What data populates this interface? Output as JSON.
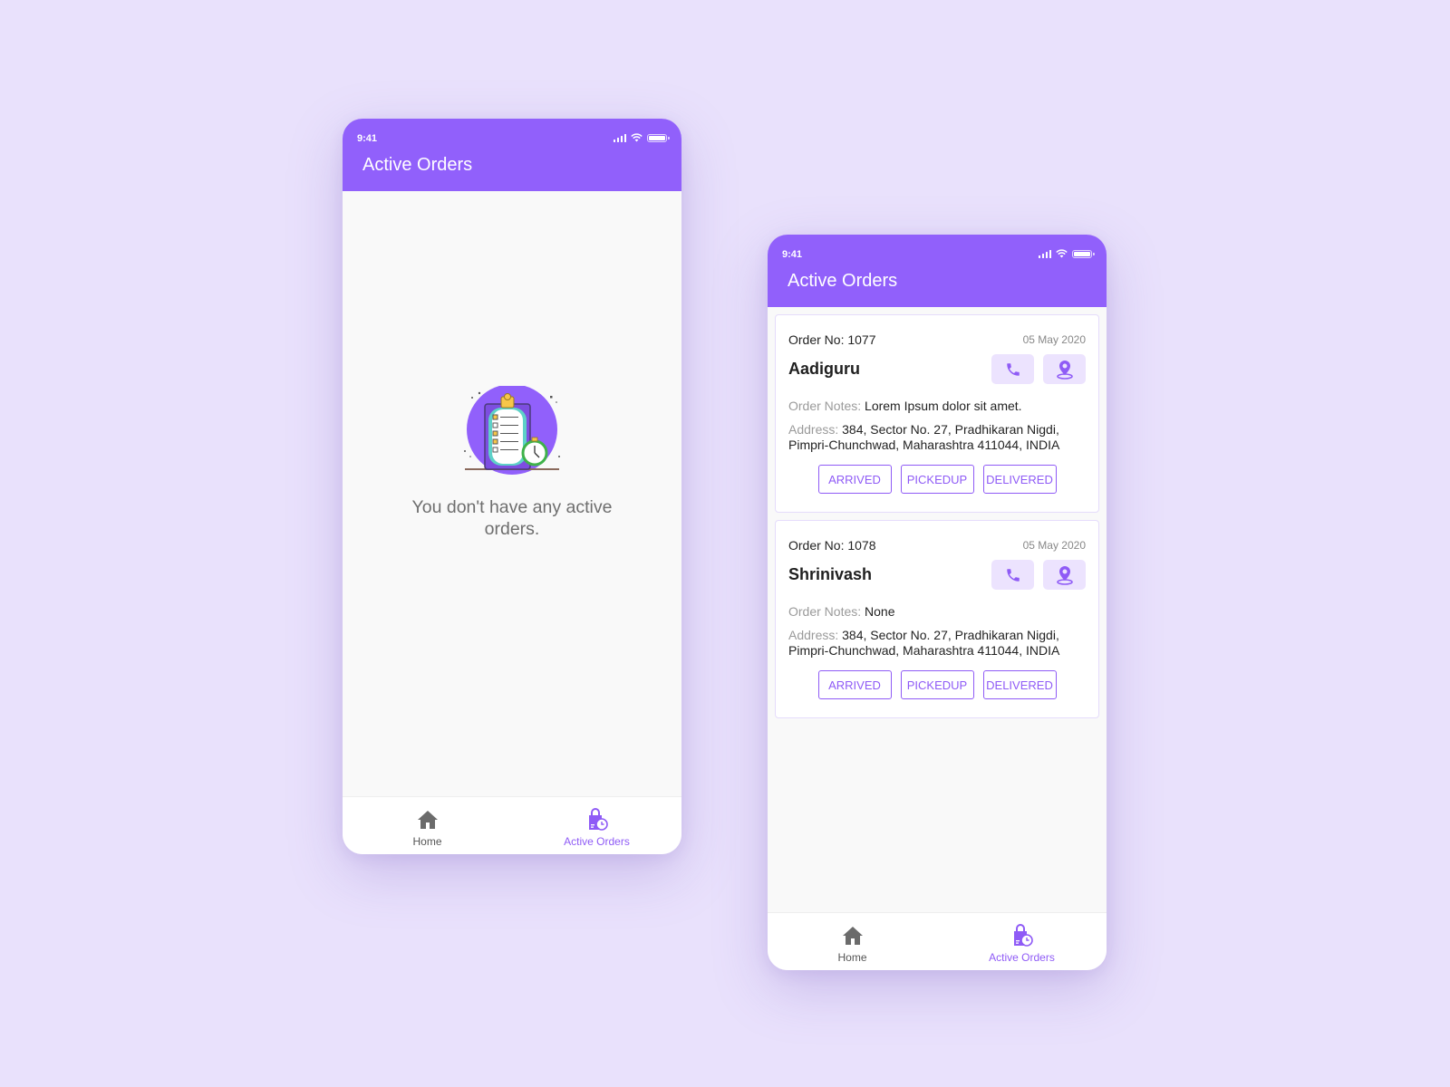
{
  "colors": {
    "background": "#e9e1fc",
    "accent": "#9160fb",
    "accent_light": "#ece3fe",
    "nav_active": "#8f5bf6",
    "nav_inactive": "#555555"
  },
  "screens": [
    {
      "status_bar": {
        "time": "9:41"
      },
      "app_bar": {
        "title": "Active Orders"
      },
      "empty_state": {
        "illustration": "clipboard-stopwatch-illustration",
        "message": "You don't have any active orders."
      },
      "bottom_nav": {
        "items": [
          {
            "label": "Home",
            "icon": "home-icon",
            "active": false
          },
          {
            "label": "Active Orders",
            "icon": "shopping-bag-clock-icon",
            "active": true
          }
        ]
      }
    },
    {
      "status_bar": {
        "time": "9:41"
      },
      "app_bar": {
        "title": "Active Orders"
      },
      "orders": [
        {
          "order_no_label": "Order No: 1077",
          "date": "05 May 2020",
          "customer": "Aadiguru",
          "notes_label": "Order Notes:",
          "notes": " Lorem Ipsum dolor sit amet.",
          "address_label": "Address:",
          "address": " 384, Sector No. 27, Pradhikaran Nigdi, Pimpri-Chunchwad, Maharashtra 411044, INDIA",
          "actions": [
            "ARRIVED",
            "PICKEDUP",
            "DELIVERED"
          ]
        },
        {
          "order_no_label": "Order No: 1078",
          "date": "05 May 2020",
          "customer": "Shrinivash",
          "notes_label": "Order Notes:",
          "notes": " None",
          "address_label": "Address:",
          "address": " 384, Sector No. 27, Pradhikaran Nigdi, Pimpri-Chunchwad, Maharashtra 411044, INDIA",
          "actions": [
            "ARRIVED",
            "PICKEDUP",
            "DELIVERED"
          ]
        }
      ],
      "bottom_nav": {
        "items": [
          {
            "label": "Home",
            "icon": "home-icon",
            "active": false
          },
          {
            "label": "Active Orders",
            "icon": "shopping-bag-clock-icon",
            "active": true
          }
        ]
      }
    }
  ]
}
